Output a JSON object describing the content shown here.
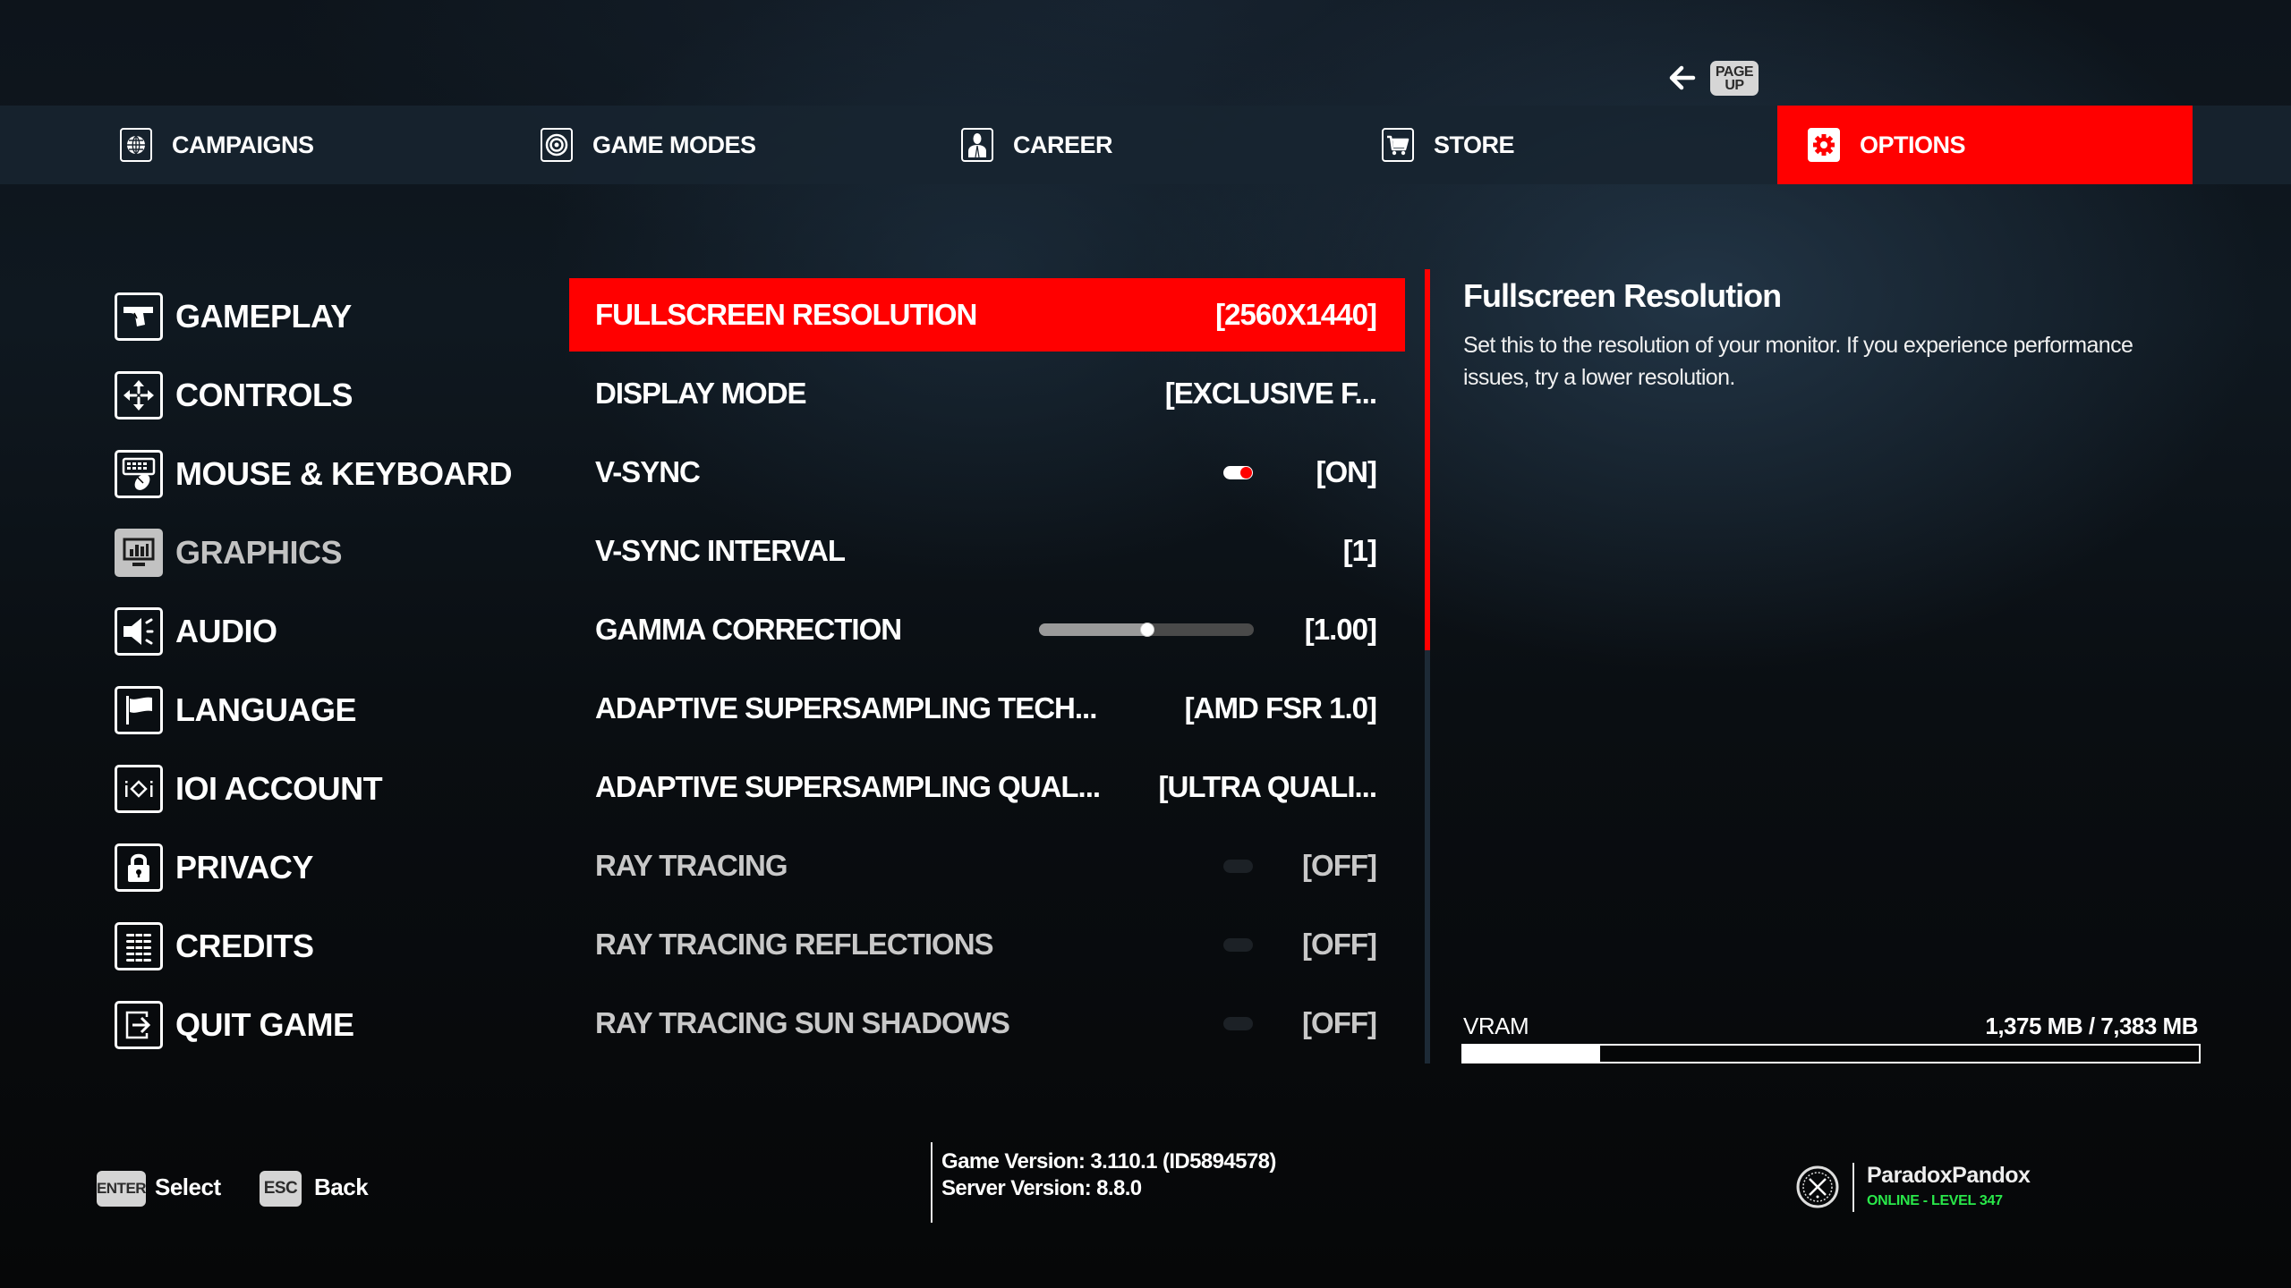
{
  "page_up_hint": {
    "icon": "arrow-left-icon",
    "key_line1": "PAGE",
    "key_line2": "UP"
  },
  "topnav": {
    "tabs": [
      {
        "label": "CAMPAIGNS",
        "icon": "globe-icon",
        "active": false
      },
      {
        "label": "GAME MODES",
        "icon": "target-icon",
        "active": false
      },
      {
        "label": "CAREER",
        "icon": "agent-icon",
        "active": false
      },
      {
        "label": "STORE",
        "icon": "cart-icon",
        "active": false
      },
      {
        "label": "OPTIONS",
        "icon": "gear-icon",
        "active": true
      }
    ]
  },
  "menu": {
    "items": [
      {
        "label": "GAMEPLAY",
        "icon": "pistol-icon"
      },
      {
        "label": "CONTROLS",
        "icon": "move-arrows-icon"
      },
      {
        "label": "MOUSE & KEYBOARD",
        "icon": "keyboard-mouse-icon"
      },
      {
        "label": "GRAPHICS",
        "icon": "monitor-chart-icon",
        "current": true
      },
      {
        "label": "AUDIO",
        "icon": "speaker-icon"
      },
      {
        "label": "LANGUAGE",
        "icon": "flag-icon"
      },
      {
        "label": "IOI ACCOUNT",
        "icon": "ioi-logo-icon"
      },
      {
        "label": "PRIVACY",
        "icon": "lock-icon"
      },
      {
        "label": "CREDITS",
        "icon": "list-icon"
      },
      {
        "label": "QUIT GAME",
        "icon": "exit-icon"
      }
    ]
  },
  "settings": {
    "rows": [
      {
        "label": "FULLSCREEN RESOLUTION",
        "value": "[2560X1440]",
        "selected": true
      },
      {
        "label": "DISPLAY MODE",
        "value": "[EXCLUSIVE F..."
      },
      {
        "label": "V-SYNC",
        "value": "[ON]",
        "toggle": "on"
      },
      {
        "label": "V-SYNC INTERVAL",
        "value": "[1]"
      },
      {
        "label": "GAMMA CORRECTION",
        "value": "[1.00]",
        "slider_percent": 50
      },
      {
        "label": "ADAPTIVE SUPERSAMPLING TECH...",
        "value": "[AMD FSR 1.0]"
      },
      {
        "label": "ADAPTIVE SUPERSAMPLING QUAL...",
        "value": "[ULTRA QUALI..."
      },
      {
        "label": "RAY TRACING",
        "value": "[OFF]",
        "toggle": "off",
        "disabled": true
      },
      {
        "label": "RAY TRACING REFLECTIONS",
        "value": "[OFF]",
        "toggle": "off",
        "disabled": true
      },
      {
        "label": "RAY TRACING SUN SHADOWS",
        "value": "[OFF]",
        "toggle": "off",
        "disabled": true
      }
    ],
    "scroll_visible_fraction": 0.48
  },
  "description": {
    "title": "Fullscreen Resolution",
    "body": "Set this to the resolution of your monitor. If you experience performance issues, try a lower resolution."
  },
  "vram": {
    "label": "VRAM",
    "value": "1,375 MB / 7,383 MB",
    "used_mb": 1375,
    "total_mb": 7383
  },
  "footer": {
    "hints": [
      {
        "key": "ENTER",
        "label": "Select"
      },
      {
        "key": "ESC",
        "label": "Back"
      }
    ],
    "game_version": "Game Version: 3.110.1 (ID5894578)",
    "server_version": "Server Version: 8.8.0",
    "profile": {
      "name": "ParadoxPandox",
      "status": "ONLINE - LEVEL 347"
    }
  },
  "colors": {
    "accent": "#ff0000",
    "online": "#29e84a"
  }
}
